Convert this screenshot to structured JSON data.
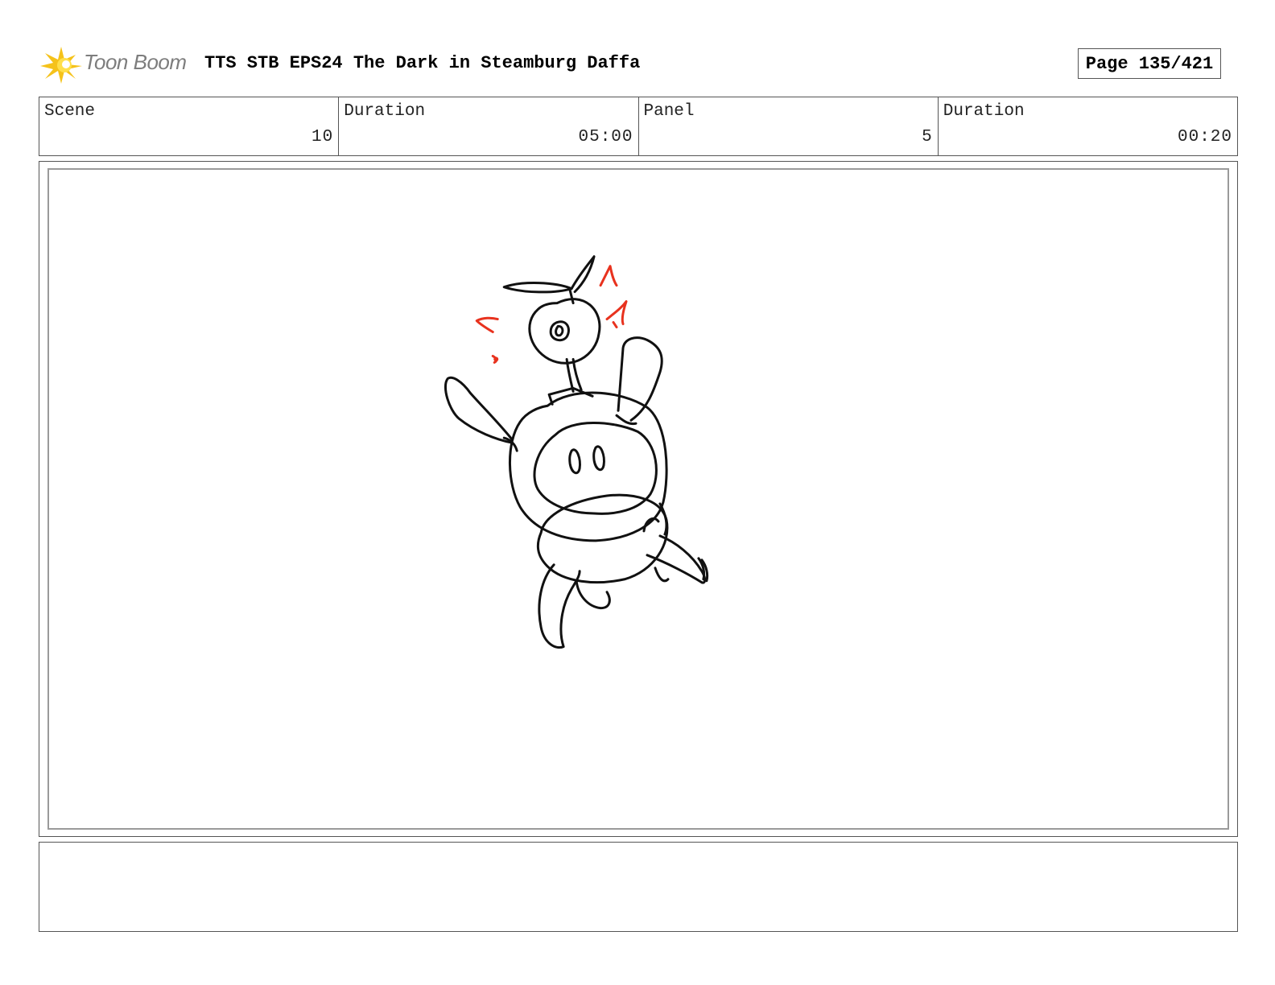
{
  "header": {
    "logo_text": "Toon Boom",
    "title": "TTS STB EPS24 The Dark in Steamburg Daffa",
    "page_label": "Page 135/421"
  },
  "info": {
    "scene_label": "Scene",
    "scene_value": "10",
    "scene_duration_label": "Duration",
    "scene_duration_value": "05:00",
    "panel_label": "Panel",
    "panel_value": "5",
    "panel_duration_label": "Duration",
    "panel_duration_value": "00:20"
  },
  "colors": {
    "logo_star": "#f5c21a",
    "sketch_line": "#111111",
    "sketch_accent": "#e8321e",
    "frame_border": "#555555"
  },
  "icons": {
    "logo": "toon-boom-star-icon"
  },
  "notes": {
    "text": ""
  }
}
